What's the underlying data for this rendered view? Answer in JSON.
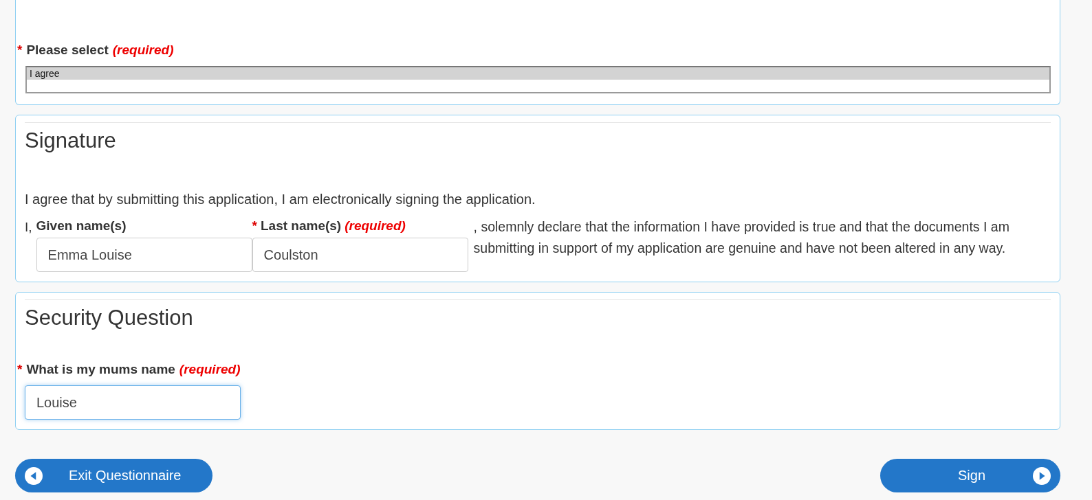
{
  "consent": {
    "label": "Please select",
    "marker": "*",
    "note": "(required)",
    "options": [
      {
        "label": "I agree",
        "selected": true
      }
    ]
  },
  "signature": {
    "title": "Signature",
    "statement": "I agree that by submitting this application, I am electronically signing the application.",
    "prefix": "I,",
    "fields": [
      {
        "label": "Given name(s)",
        "value": "Emma Louise"
      },
      {
        "label": "Last name(s)",
        "marker": "*",
        "note": "(required)",
        "value": "Coulston"
      }
    ],
    "declaration": ", solemnly declare that the information I have provided is true and that the documents I am submitting in support of my application are genuine and have not been altered in any way."
  },
  "security": {
    "title": "Security Question",
    "label": "What is my mums name",
    "marker": "*",
    "note": "(required)",
    "value": "Louise",
    "focused": true
  },
  "buttons": [
    {
      "label": "Exit Questionnaire",
      "kind": "back"
    },
    {
      "label": "Sign",
      "kind": "next"
    }
  ]
}
